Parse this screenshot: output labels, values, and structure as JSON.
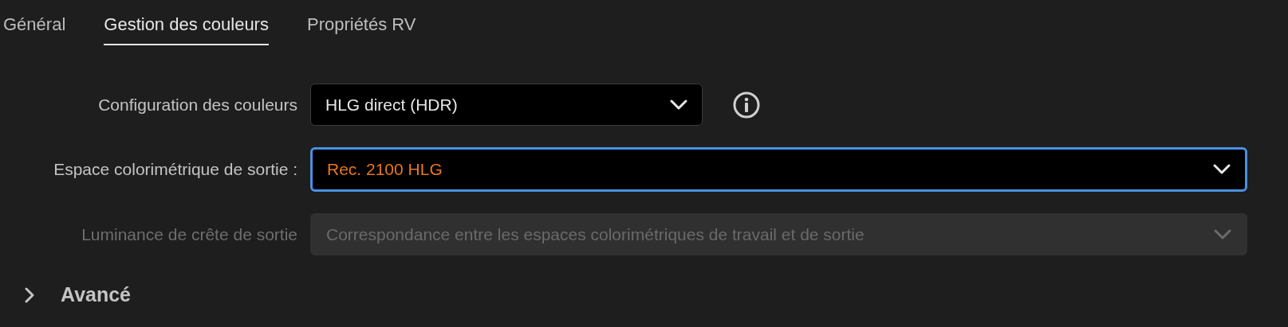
{
  "tabs": [
    {
      "label": "Général",
      "selected": false
    },
    {
      "label": "Gestion des couleurs",
      "selected": true
    },
    {
      "label": "Propriétés RV",
      "selected": false
    }
  ],
  "fields": [
    {
      "label": "Configuration des couleurs",
      "value": "HLG direct (HDR)",
      "focused": false,
      "disabled": false,
      "info": true,
      "wide": false
    },
    {
      "label": "Espace colorimétrique de sortie :",
      "value": "Rec. 2100 HLG",
      "focused": true,
      "disabled": false,
      "info": false,
      "wide": true
    },
    {
      "label": "Luminance de crête de sortie",
      "value": "Correspondance entre les espaces colorimétriques de travail et de sortie",
      "focused": false,
      "disabled": true,
      "info": false,
      "wide": true
    }
  ],
  "advanced": {
    "label": "Avancé",
    "expanded": false
  }
}
